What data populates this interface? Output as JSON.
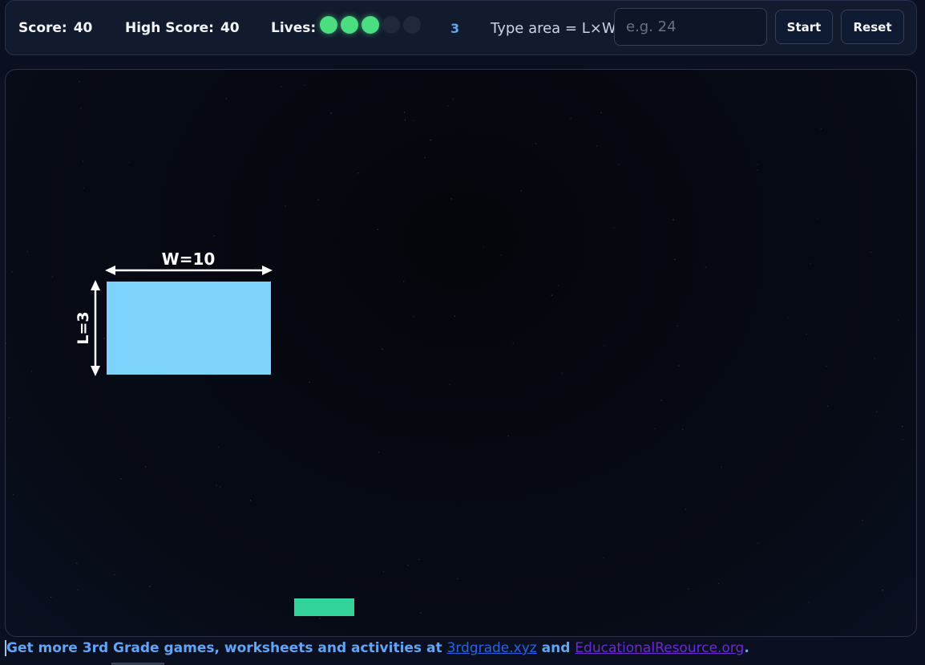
{
  "hud": {
    "score_label": "Score:",
    "score_value": "40",
    "high_score_label": "High Score:",
    "high_score_value": "40",
    "lives_label": "Lives:",
    "lives_total": 5,
    "lives_remaining": 3,
    "lives_count": "3",
    "prompt": "Type area = L×W",
    "input_value": "",
    "input_placeholder": "e.g. 24",
    "start_label": "Start",
    "reset_label": "Reset"
  },
  "game": {
    "shape": {
      "width_label": "W=10",
      "length_label": "L=3",
      "width": 10,
      "length": 3,
      "color": "#7dd3fc"
    },
    "paddle_color": "#34d399"
  },
  "footer": {
    "text_before": "Get more 3rd Grade games, worksheets and activities at ",
    "link1": "3rdgrade.xyz",
    "text_middle": " and ",
    "link2": "EducationalResource.org",
    "text_after": "."
  },
  "colors": {
    "accent": "#60a5fa",
    "life_on": "#4ade80",
    "life_off": "#1e293b"
  }
}
